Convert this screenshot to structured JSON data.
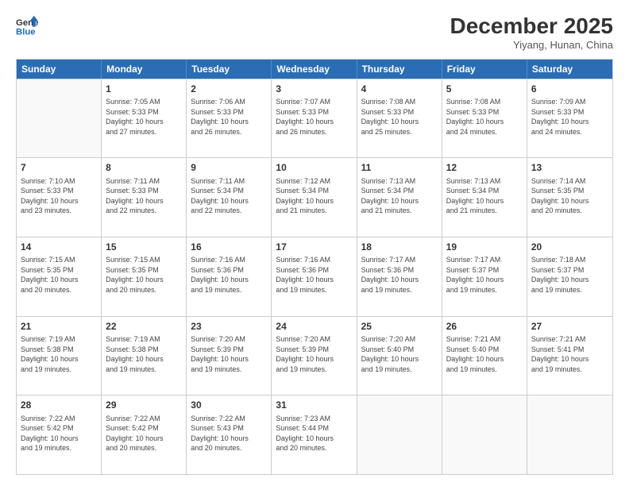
{
  "logo": {
    "line1": "General",
    "line2": "Blue"
  },
  "header": {
    "month": "December 2025",
    "location": "Yiyang, Hunan, China"
  },
  "days": [
    "Sunday",
    "Monday",
    "Tuesday",
    "Wednesday",
    "Thursday",
    "Friday",
    "Saturday"
  ],
  "rows": [
    [
      {
        "day": "",
        "info": ""
      },
      {
        "day": "1",
        "info": "Sunrise: 7:05 AM\nSunset: 5:33 PM\nDaylight: 10 hours\nand 27 minutes."
      },
      {
        "day": "2",
        "info": "Sunrise: 7:06 AM\nSunset: 5:33 PM\nDaylight: 10 hours\nand 26 minutes."
      },
      {
        "day": "3",
        "info": "Sunrise: 7:07 AM\nSunset: 5:33 PM\nDaylight: 10 hours\nand 26 minutes."
      },
      {
        "day": "4",
        "info": "Sunrise: 7:08 AM\nSunset: 5:33 PM\nDaylight: 10 hours\nand 25 minutes."
      },
      {
        "day": "5",
        "info": "Sunrise: 7:08 AM\nSunset: 5:33 PM\nDaylight: 10 hours\nand 24 minutes."
      },
      {
        "day": "6",
        "info": "Sunrise: 7:09 AM\nSunset: 5:33 PM\nDaylight: 10 hours\nand 24 minutes."
      }
    ],
    [
      {
        "day": "7",
        "info": "Sunrise: 7:10 AM\nSunset: 5:33 PM\nDaylight: 10 hours\nand 23 minutes."
      },
      {
        "day": "8",
        "info": "Sunrise: 7:11 AM\nSunset: 5:33 PM\nDaylight: 10 hours\nand 22 minutes."
      },
      {
        "day": "9",
        "info": "Sunrise: 7:11 AM\nSunset: 5:34 PM\nDaylight: 10 hours\nand 22 minutes."
      },
      {
        "day": "10",
        "info": "Sunrise: 7:12 AM\nSunset: 5:34 PM\nDaylight: 10 hours\nand 21 minutes."
      },
      {
        "day": "11",
        "info": "Sunrise: 7:13 AM\nSunset: 5:34 PM\nDaylight: 10 hours\nand 21 minutes."
      },
      {
        "day": "12",
        "info": "Sunrise: 7:13 AM\nSunset: 5:34 PM\nDaylight: 10 hours\nand 21 minutes."
      },
      {
        "day": "13",
        "info": "Sunrise: 7:14 AM\nSunset: 5:35 PM\nDaylight: 10 hours\nand 20 minutes."
      }
    ],
    [
      {
        "day": "14",
        "info": "Sunrise: 7:15 AM\nSunset: 5:35 PM\nDaylight: 10 hours\nand 20 minutes."
      },
      {
        "day": "15",
        "info": "Sunrise: 7:15 AM\nSunset: 5:35 PM\nDaylight: 10 hours\nand 20 minutes."
      },
      {
        "day": "16",
        "info": "Sunrise: 7:16 AM\nSunset: 5:36 PM\nDaylight: 10 hours\nand 19 minutes."
      },
      {
        "day": "17",
        "info": "Sunrise: 7:16 AM\nSunset: 5:36 PM\nDaylight: 10 hours\nand 19 minutes."
      },
      {
        "day": "18",
        "info": "Sunrise: 7:17 AM\nSunset: 5:36 PM\nDaylight: 10 hours\nand 19 minutes."
      },
      {
        "day": "19",
        "info": "Sunrise: 7:17 AM\nSunset: 5:37 PM\nDaylight: 10 hours\nand 19 minutes."
      },
      {
        "day": "20",
        "info": "Sunrise: 7:18 AM\nSunset: 5:37 PM\nDaylight: 10 hours\nand 19 minutes."
      }
    ],
    [
      {
        "day": "21",
        "info": "Sunrise: 7:19 AM\nSunset: 5:38 PM\nDaylight: 10 hours\nand 19 minutes."
      },
      {
        "day": "22",
        "info": "Sunrise: 7:19 AM\nSunset: 5:38 PM\nDaylight: 10 hours\nand 19 minutes."
      },
      {
        "day": "23",
        "info": "Sunrise: 7:20 AM\nSunset: 5:39 PM\nDaylight: 10 hours\nand 19 minutes."
      },
      {
        "day": "24",
        "info": "Sunrise: 7:20 AM\nSunset: 5:39 PM\nDaylight: 10 hours\nand 19 minutes."
      },
      {
        "day": "25",
        "info": "Sunrise: 7:20 AM\nSunset: 5:40 PM\nDaylight: 10 hours\nand 19 minutes."
      },
      {
        "day": "26",
        "info": "Sunrise: 7:21 AM\nSunset: 5:40 PM\nDaylight: 10 hours\nand 19 minutes."
      },
      {
        "day": "27",
        "info": "Sunrise: 7:21 AM\nSunset: 5:41 PM\nDaylight: 10 hours\nand 19 minutes."
      }
    ],
    [
      {
        "day": "28",
        "info": "Sunrise: 7:22 AM\nSunset: 5:42 PM\nDaylight: 10 hours\nand 19 minutes."
      },
      {
        "day": "29",
        "info": "Sunrise: 7:22 AM\nSunset: 5:42 PM\nDaylight: 10 hours\nand 20 minutes."
      },
      {
        "day": "30",
        "info": "Sunrise: 7:22 AM\nSunset: 5:43 PM\nDaylight: 10 hours\nand 20 minutes."
      },
      {
        "day": "31",
        "info": "Sunrise: 7:23 AM\nSunset: 5:44 PM\nDaylight: 10 hours\nand 20 minutes."
      },
      {
        "day": "",
        "info": ""
      },
      {
        "day": "",
        "info": ""
      },
      {
        "day": "",
        "info": ""
      }
    ]
  ]
}
